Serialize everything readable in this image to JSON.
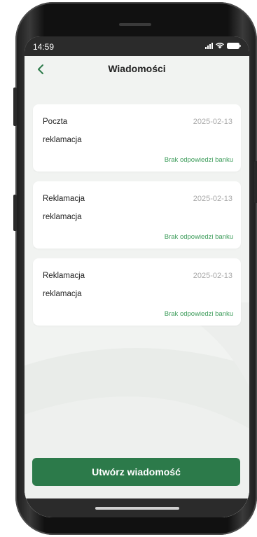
{
  "status_bar": {
    "time": "14:59"
  },
  "header": {
    "title": "Wiadomości",
    "back_icon": "chevron-left-icon"
  },
  "messages": [
    {
      "title": "Poczta",
      "date": "2025-02-13",
      "subject": "reklamacja",
      "status": "Brak odpowiedzi banku"
    },
    {
      "title": "Reklamacja",
      "date": "2025-02-13",
      "subject": "reklamacja",
      "status": "Brak odpowiedzi banku"
    },
    {
      "title": "Reklamacja",
      "date": "2025-02-13",
      "subject": "reklamacja",
      "status": "Brak odpowiedzi banku"
    }
  ],
  "actions": {
    "create_label": "Utwórz wiadomość"
  },
  "colors": {
    "accent": "#2c7a4a",
    "status_text": "#3c9c5a",
    "date_text": "#a8a8a8",
    "screen_bg": "#f1f3f1"
  }
}
